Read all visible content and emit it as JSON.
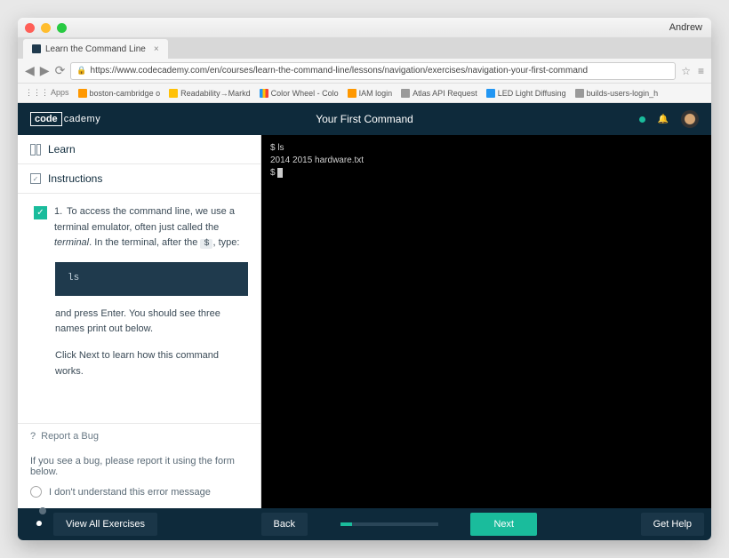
{
  "os": {
    "user": "Andrew"
  },
  "browser": {
    "tab_title": "Learn the Command Line",
    "url": "https://www.codecademy.com/en/courses/learn-the-command-line/lessons/navigation/exercises/navigation-your-first-command",
    "bookmarks": {
      "apps": "Apps",
      "items": [
        "boston-cambridge o",
        "Readability→Markd",
        "Color Wheel - Colo",
        "IAM login",
        "Atlas API Request",
        "LED Light Diffusing",
        "builds-users-login_h"
      ]
    }
  },
  "header": {
    "logo_box": "code",
    "logo_text": "cademy",
    "title": "Your First Command"
  },
  "sidebar": {
    "learn": "Learn",
    "instructions": "Instructions",
    "step_number": "1.",
    "step_text_1": "To access the command line, we use a terminal emulator, often just called the ",
    "step_text_em": "terminal",
    "step_text_2": ". In the terminal, after the ",
    "step_text_prompt": "$",
    "step_text_3": ", type:",
    "code": "ls",
    "step_text_4": "and press Enter. You should see three names print out below.",
    "step_text_5": "Click Next to learn how this command works.",
    "bug_title": "Report a Bug",
    "bug_body": "If you see a bug, please report it using the form below.",
    "bug_option": "I don't understand this error message"
  },
  "terminal": {
    "line1": "$ ls",
    "line2": "2014  2015  hardware.txt",
    "line3": "$ "
  },
  "footer": {
    "view_all": "View All Exercises",
    "back": "Back",
    "next": "Next",
    "help": "Get Help"
  }
}
